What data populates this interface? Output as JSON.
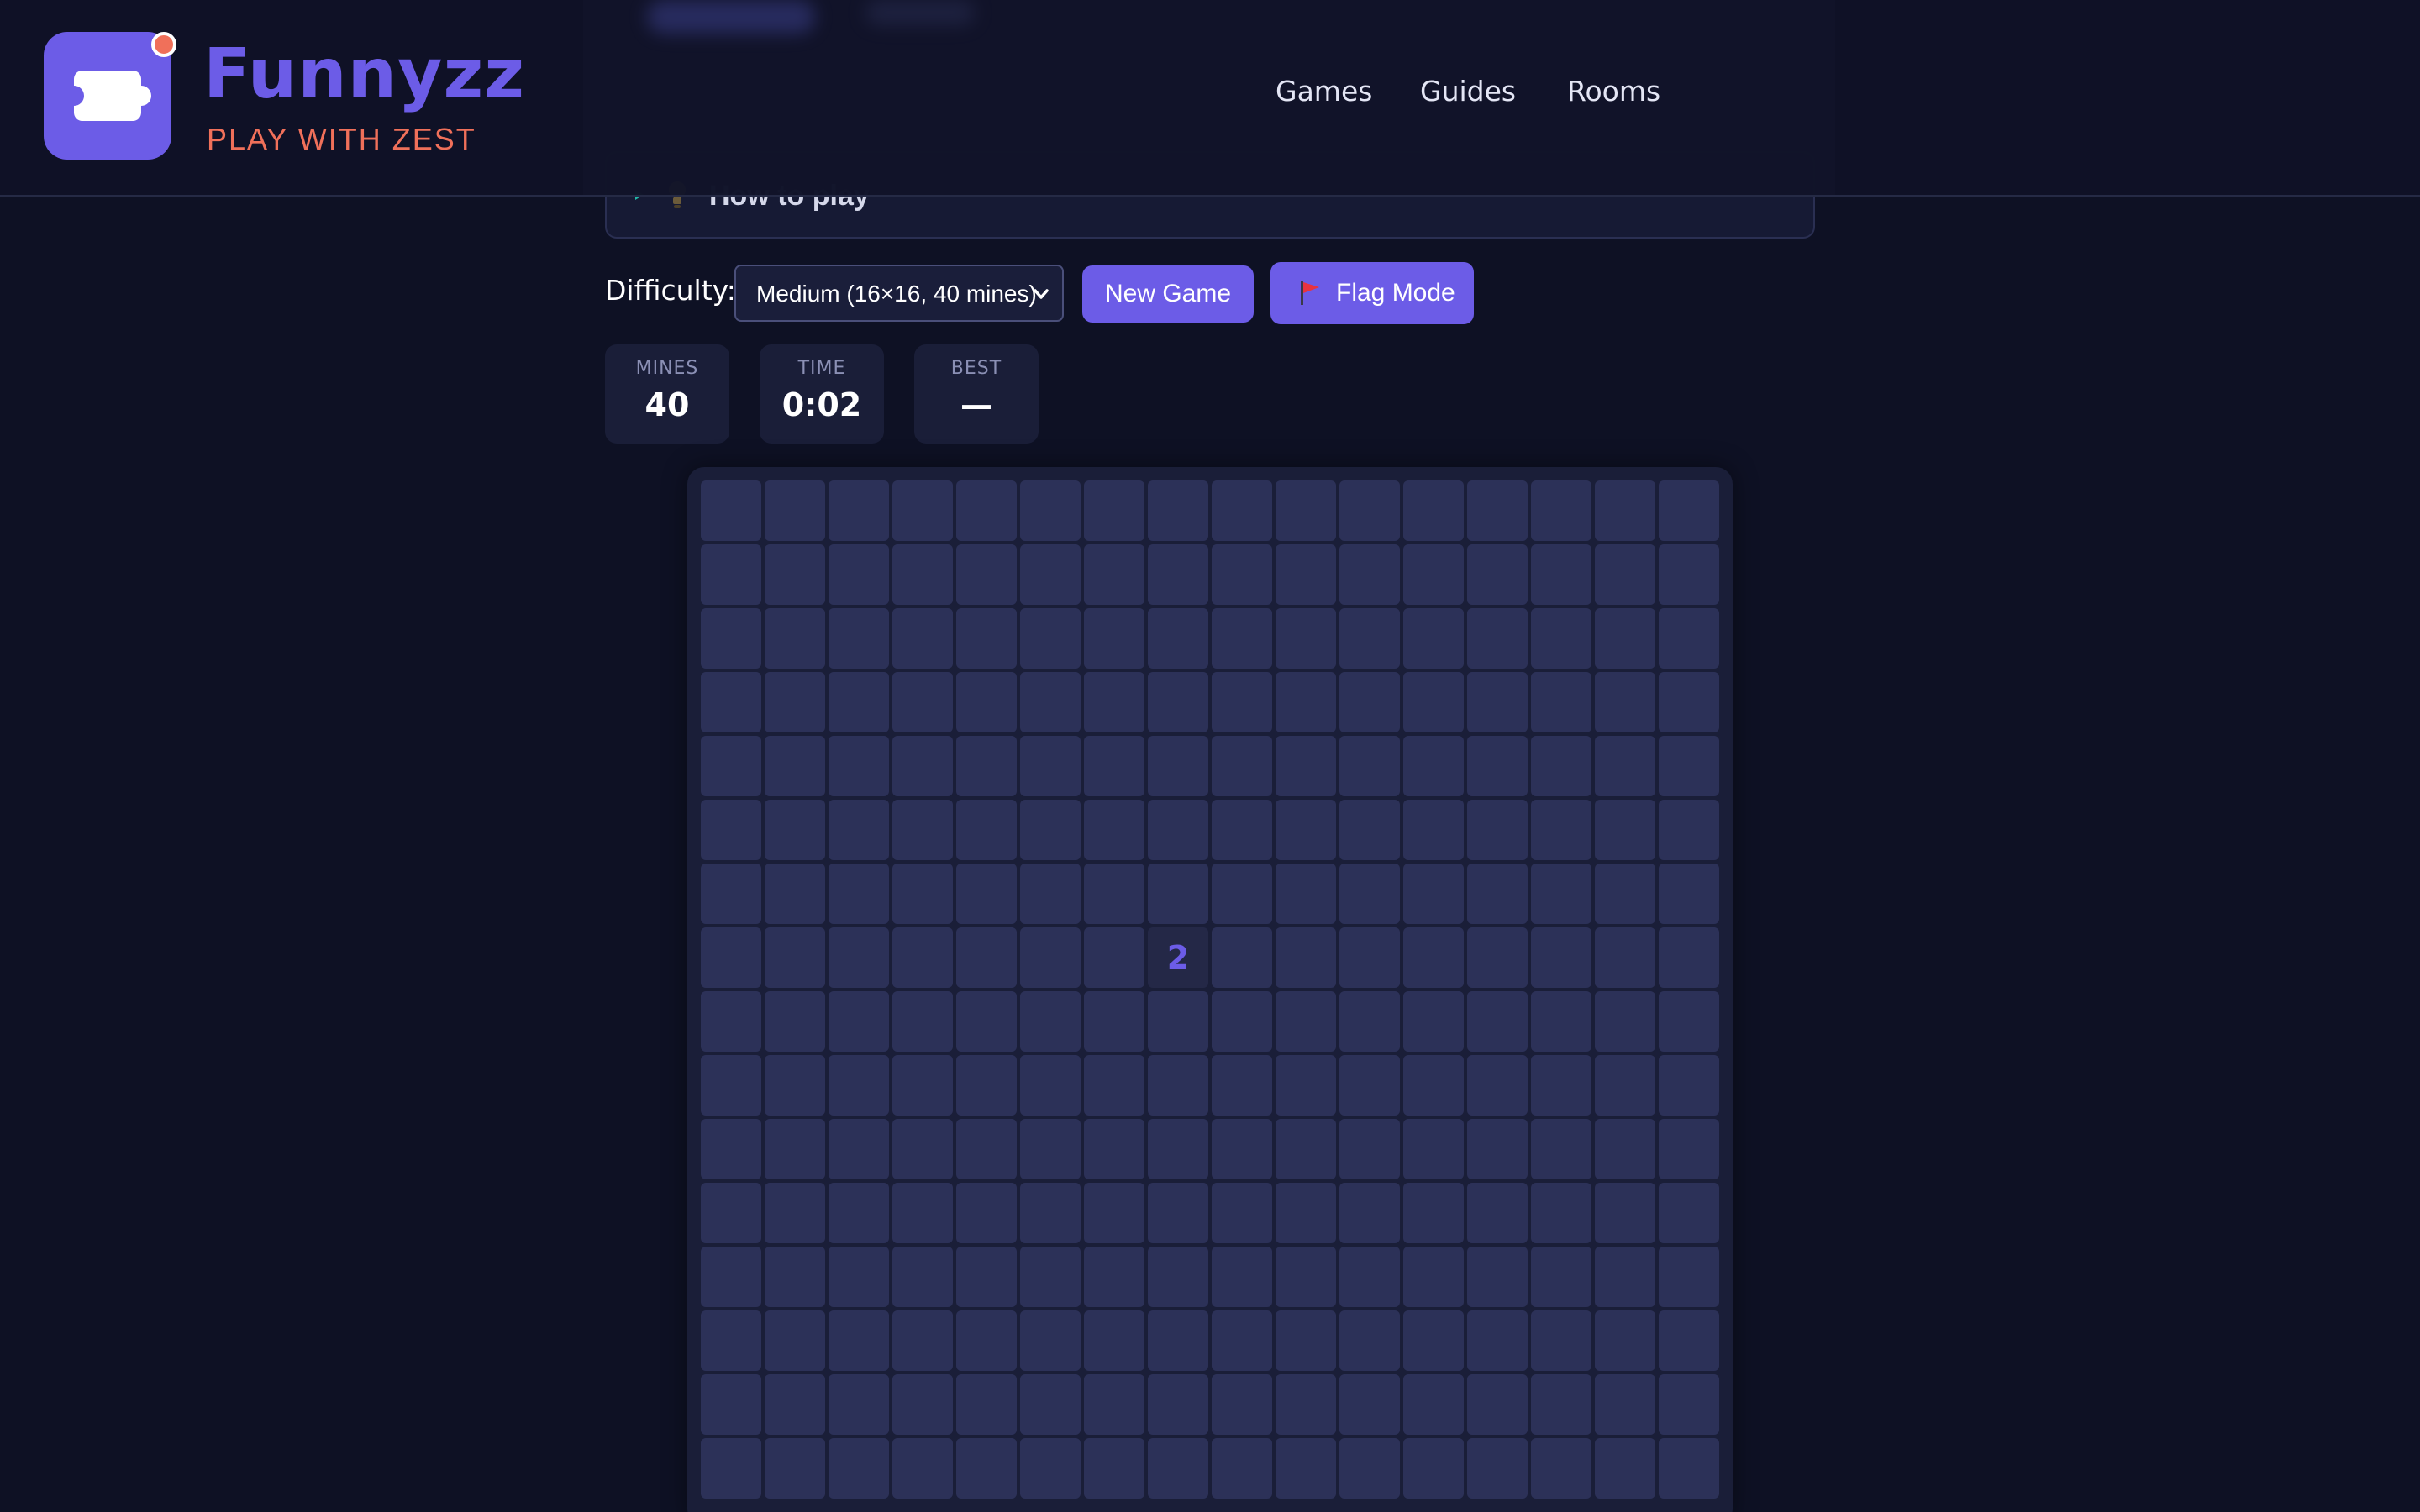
{
  "brand": {
    "name": "Funnyzz",
    "tagline": "PLAY WITH ZEST"
  },
  "nav": {
    "items": [
      {
        "label": "Games"
      },
      {
        "label": "Guides"
      },
      {
        "label": "Rooms"
      }
    ]
  },
  "howto": {
    "label": "How to play"
  },
  "controls": {
    "difficulty_label": "Difficulty:",
    "difficulty_value": "Medium (16×16, 40 mines)",
    "new_game_label": "New Game",
    "flag_mode_label": "Flag Mode"
  },
  "stats": {
    "mines": {
      "label": "MINES",
      "value": "40"
    },
    "time": {
      "label": "TIME",
      "value": "0:02"
    },
    "best": {
      "label": "BEST",
      "value": "—"
    }
  },
  "board": {
    "rows": 16,
    "cols": 16,
    "revealed": [
      {
        "row": 7,
        "col": 7,
        "value": "2"
      }
    ]
  },
  "colors": {
    "accent": "#6c5ce7",
    "brand_orange": "#f0705a",
    "background": "#0e1124",
    "cell": "#2c3158"
  },
  "icons": {
    "logo": "puzzle-piece-icon",
    "howto_arrow": "caret-right-icon",
    "howto_bulb": "light-bulb-icon",
    "difficulty": "chevron-down-icon",
    "flag_mode": "flag-icon"
  }
}
